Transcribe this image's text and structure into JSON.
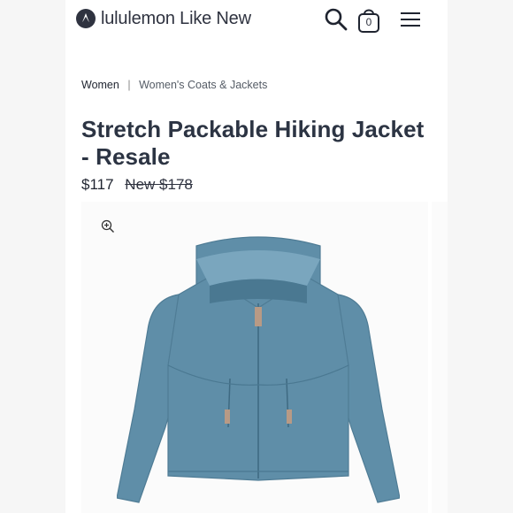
{
  "header": {
    "brand_name": "lululemon",
    "brand_suffix": "Like New",
    "bag_count": "0",
    "icons": [
      "lululemon-logo-icon",
      "search-icon",
      "bag-icon",
      "menu-icon"
    ]
  },
  "breadcrumb": {
    "root": "Women",
    "separator": "|",
    "category": "Women's Coats & Jackets"
  },
  "product": {
    "title": "Stretch Packable Hiking Jacket - Resale",
    "price": "$117",
    "original_price": "New $178",
    "image_color": "#5f8ea8"
  },
  "colors": {
    "text_primary": "#2c3443",
    "jacket_blue": "#5f8ea8"
  }
}
